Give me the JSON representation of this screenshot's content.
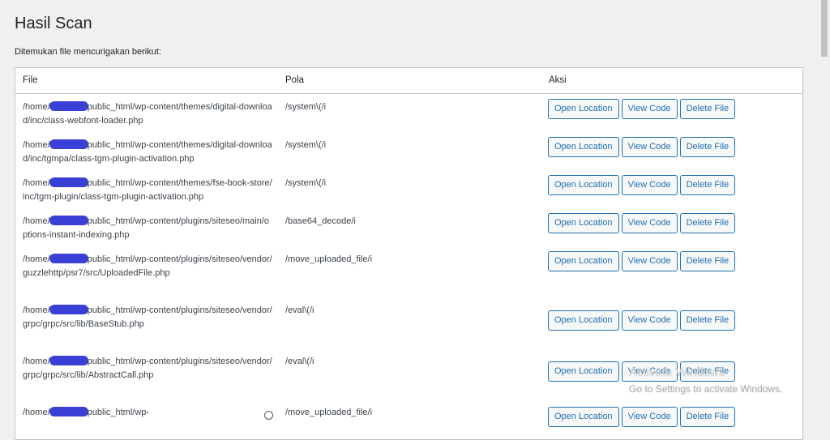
{
  "page": {
    "title": "Hasil Scan",
    "intro": "Ditemukan file mencurigakan berikut:"
  },
  "table": {
    "headers": {
      "file": "File",
      "pola": "Pola",
      "aksi": "Aksi"
    },
    "buttons": {
      "open": "Open Location",
      "view": "View Code",
      "delete": "Delete File"
    },
    "rows": [
      {
        "pre": "/home/",
        "post": "public_html/wp-content/themes/digital-download/inc/class-webfont-loader.php",
        "pola": "/system\\(/i"
      },
      {
        "pre": "/home/",
        "post": "public_html/wp-content/themes/digital-download/inc/tgmpa/class-tgm-plugin-activation.php",
        "pola": "/system\\(/i"
      },
      {
        "pre": "/home/",
        "post": "public_html/wp-content/themes/fse-book-store/inc/tgm-plugin/class-tgm-plugin-activation.php",
        "pola": "/system\\(/i"
      },
      {
        "pre": "/home/",
        "post": "public_html/wp-content/plugins/siteseo/main/options-instant-indexing.php",
        "pola": "/base64_decode/i"
      },
      {
        "pre": "/home/",
        "post": "public_html/wp-content/plugins/siteseo/vendor/guzzlehttp/psr7/src/UploadedFile.php",
        "pola": "/move_uploaded_file/i"
      },
      {
        "pre": "/home/",
        "post": "public_html/wp-content/plugins/siteseo/vendor/grpc/grpc/src/lib/BaseStub.php",
        "pola": "/eval\\(/i"
      },
      {
        "pre": "/home/",
        "post": "public_html/wp-content/plugins/siteseo/vendor/grpc/grpc/src/lib/AbstractCall.php",
        "pola": "/eval\\(/i"
      },
      {
        "pre": "/home/",
        "post": "public_html/wp-",
        "pola": "/move_uploaded_file/i"
      }
    ]
  },
  "watermark": {
    "line1": "Activate Windows",
    "line2": "Go to Settings to activate Windows."
  }
}
